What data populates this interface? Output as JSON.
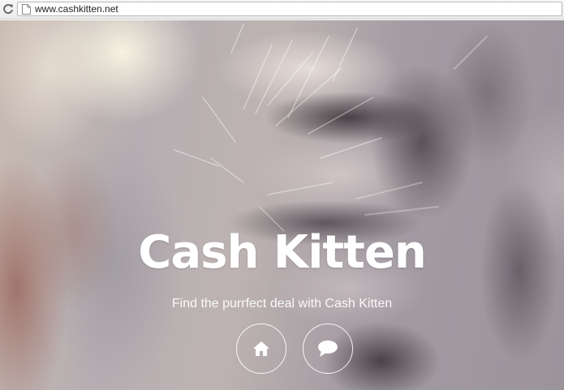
{
  "browser": {
    "url": "www.cashkitten.net",
    "icons": {
      "reload": "reload-icon",
      "page": "page-icon"
    }
  },
  "hero": {
    "title": "Cash Kitten",
    "tagline": "Find the purrfect deal with Cash Kitten",
    "buttons": [
      {
        "icon": "home-icon"
      },
      {
        "icon": "chat-bubble-icon"
      }
    ]
  },
  "colors": {
    "text": "#ffffff",
    "button_border": "#ffffff"
  }
}
